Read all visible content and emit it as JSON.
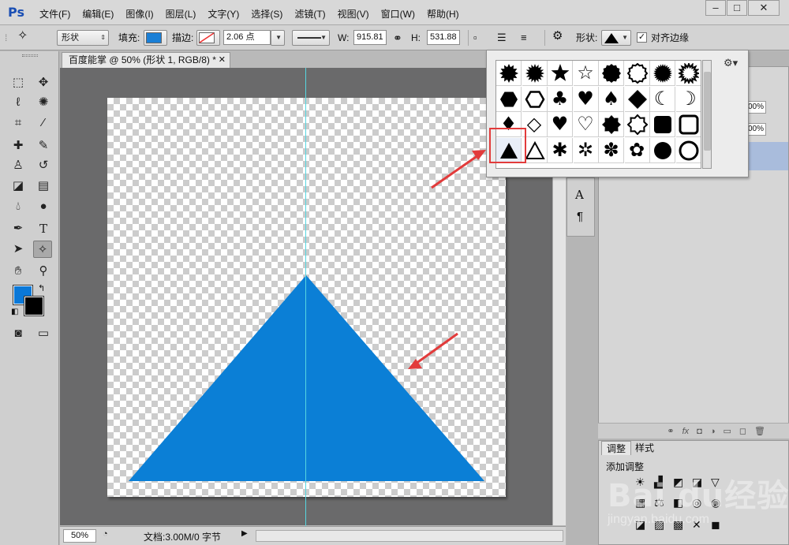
{
  "app": {
    "logo": "Ps"
  },
  "menu": [
    "文件(F)",
    "编辑(E)",
    "图像(I)",
    "图层(L)",
    "文字(Y)",
    "选择(S)",
    "滤镜(T)",
    "视图(V)",
    "窗口(W)",
    "帮助(H)"
  ],
  "window_controls": [
    "–",
    "□",
    "✕"
  ],
  "options": {
    "mode": "形状",
    "fill_label": "填充:",
    "fill_color": "#1a7fd6",
    "stroke_label": "描边:",
    "stroke_width": "2.06 点",
    "w_label": "W:",
    "w_value": "915.81",
    "h_label": "H:",
    "h_value": "531.88",
    "shape_label": "形状:",
    "align_edges_label": "对齐边缘",
    "align_edges_checked": true
  },
  "document": {
    "tab_title": "百度能掌 @ 50% (形状 1, RGB/8) *",
    "zoom": "50%",
    "doc_info": "文档:3.00M/0 字节",
    "shape_color": "#0b7fd6"
  },
  "colors": {
    "foreground": "#0a78d8",
    "background": "#000000",
    "highlight": "#e23b3b",
    "guide": "#56d6e0"
  },
  "tools": [
    "marquee-icon",
    "move-icon",
    "lasso-icon",
    "quick-select-icon",
    "crop-icon",
    "eyedropper-icon",
    "healing-brush-icon",
    "brush-icon",
    "clone-stamp-icon",
    "history-brush-icon",
    "eraser-icon",
    "gradient-icon",
    "blur-icon",
    "dodge-icon",
    "pen-icon",
    "type-icon",
    "path-select-icon",
    "custom-shape-icon",
    "hand-icon",
    "zoom-icon",
    "quick-mask-icon",
    "screen-mode-icon"
  ],
  "panels": {
    "opacity_partial": "00%",
    "fill_partial": "00%",
    "adjust_tab": "调整",
    "styles_tab": "样式",
    "add_adjustment": "添加调整"
  },
  "shape_picker": {
    "rows": [
      [
        "burst-12",
        "burst-16",
        "star-5",
        "star-outline",
        "seal-12",
        "seal-outline",
        "burst-24",
        "burst-outline"
      ],
      [
        "hexagon",
        "hexagon-outline",
        "club",
        "heart",
        "spade",
        "diamond",
        "moon",
        "moon-outline"
      ],
      [
        "diamond-card",
        "diamond-outline",
        "heart-card",
        "heart-outline",
        "badge-8",
        "badge-8-outline",
        "rounded-square",
        "rounded-square-outline"
      ],
      [
        "triangle",
        "triangle-outline",
        "splat",
        "splat-outline",
        "flower-5",
        "flower-5-outline",
        "circle",
        "circle-outline"
      ]
    ],
    "selected": "triangle"
  },
  "watermark": {
    "logo": "Bai du经验",
    "url": "jingyan.baidu.com"
  }
}
